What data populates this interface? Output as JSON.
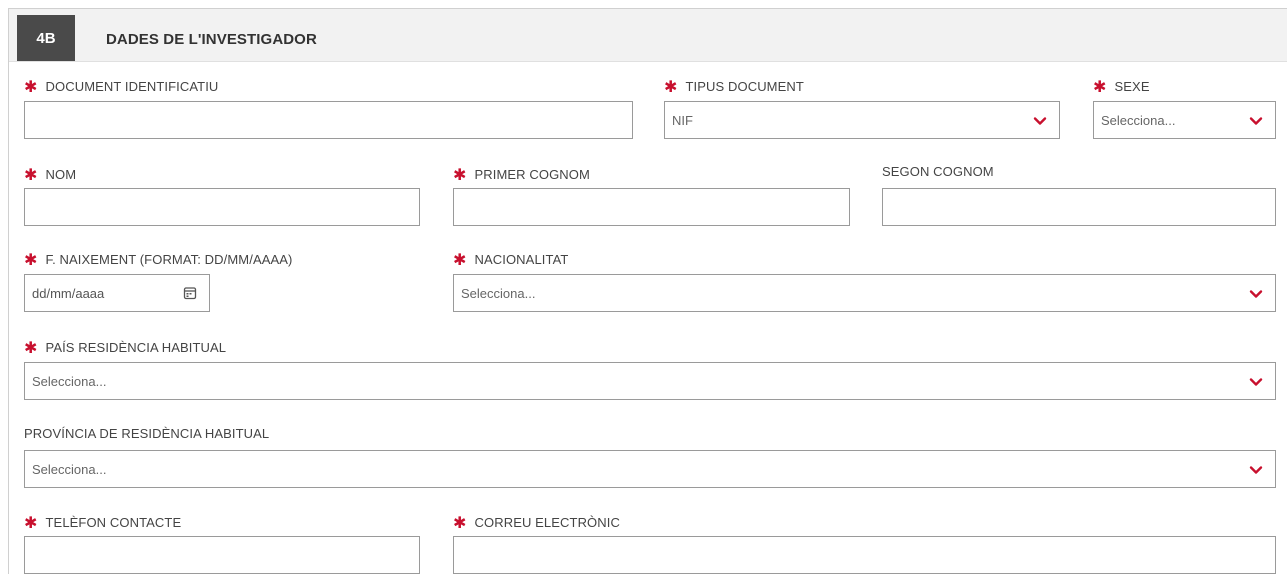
{
  "section": {
    "number": "4B",
    "title": "DADES DE L'INVESTIGADOR"
  },
  "form": {
    "document": {
      "label": "DOCUMENT IDENTIFICATIU",
      "required": "✱",
      "value": ""
    },
    "doc_type": {
      "label": "TIPUS DOCUMENT",
      "required": "✱",
      "value": "NIF"
    },
    "sex": {
      "label": "SEXE",
      "required": "✱",
      "value": "Selecciona..."
    },
    "name": {
      "label": "NOM",
      "required": "✱",
      "value": ""
    },
    "first_surname": {
      "label": "PRIMER COGNOM",
      "required": "✱",
      "value": ""
    },
    "second_surname": {
      "label": "SEGON COGNOM",
      "value": ""
    },
    "birth_date": {
      "label": "F. NAIXEMENT (FORMAT: DD/MM/AAAA)",
      "required": "✱",
      "placeholder": "dd/mm/aaaa"
    },
    "nationality": {
      "label": "NACIONALITAT",
      "required": "✱",
      "value": "Selecciona..."
    },
    "residence_country": {
      "label": "PAÍS RESIDÈNCIA HABITUAL",
      "required": "✱",
      "value": "Selecciona..."
    },
    "residence_province": {
      "label": "PROVÍNCIA DE RESIDÈNCIA HABITUAL",
      "value": "Selecciona..."
    },
    "phone": {
      "label": "TELÈFON CONTACTE",
      "required": "✱",
      "value": ""
    },
    "email": {
      "label": "CORREU ELECTRÒNIC",
      "required": "✱",
      "value": ""
    }
  },
  "colors": {
    "required": "#c8102e",
    "header_bg": "#f2f2f2",
    "badge_bg": "#4a4a4a",
    "border": "#9a9a9a"
  }
}
